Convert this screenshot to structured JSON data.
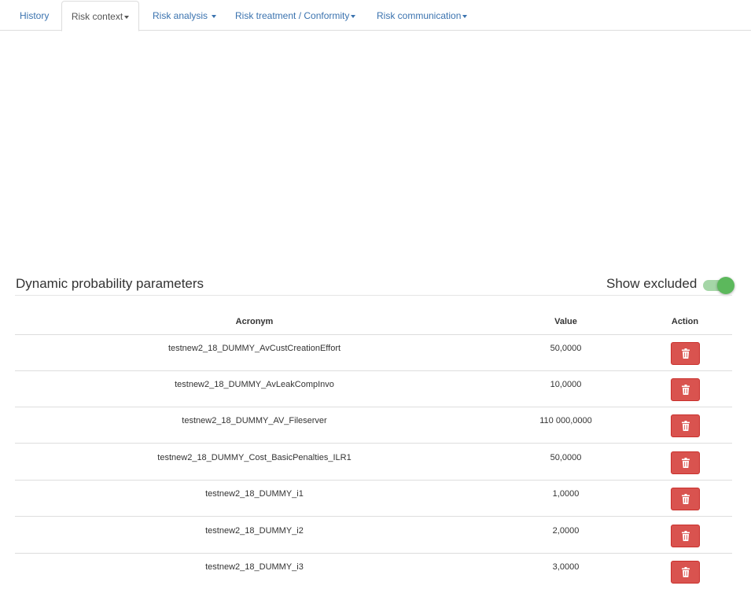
{
  "tabs": [
    {
      "label": "History",
      "dropdown": false
    },
    {
      "label": "Risk context",
      "dropdown": true,
      "active": true
    },
    {
      "label": "Risk analysis",
      "dropdown": true
    },
    {
      "label": "Risk treatment / Conformity",
      "dropdown": true
    },
    {
      "label": "Risk communication",
      "dropdown": true
    }
  ],
  "section": {
    "title": "Dynamic probability parameters",
    "toggle_label": "Show excluded",
    "toggle_on": true
  },
  "table": {
    "headers": {
      "acronym": "Acronym",
      "value": "Value",
      "action": "Action"
    },
    "rows": [
      {
        "acronym": "testnew2_18_DUMMY_AvCustCreationEffort",
        "value": "50,0000"
      },
      {
        "acronym": "testnew2_18_DUMMY_AvLeakCompInvo",
        "value": "10,0000"
      },
      {
        "acronym": "testnew2_18_DUMMY_AV_Fileserver",
        "value": "110 000,0000"
      },
      {
        "acronym": "testnew2_18_DUMMY_Cost_BasicPenalties_ILR1",
        "value": "50,0000"
      },
      {
        "acronym": "testnew2_18_DUMMY_i1",
        "value": "1,0000"
      },
      {
        "acronym": "testnew2_18_DUMMY_i2",
        "value": "2,0000"
      },
      {
        "acronym": "testnew2_18_DUMMY_i3",
        "value": "3,0000"
      }
    ]
  },
  "icons": {
    "delete": "trash-icon",
    "dropdown": "caret-down-icon"
  },
  "colors": {
    "link": "#3b73af",
    "danger": "#d9534f",
    "toggle_on": "#5cb85c",
    "toggle_track": "#a5d6a7"
  }
}
